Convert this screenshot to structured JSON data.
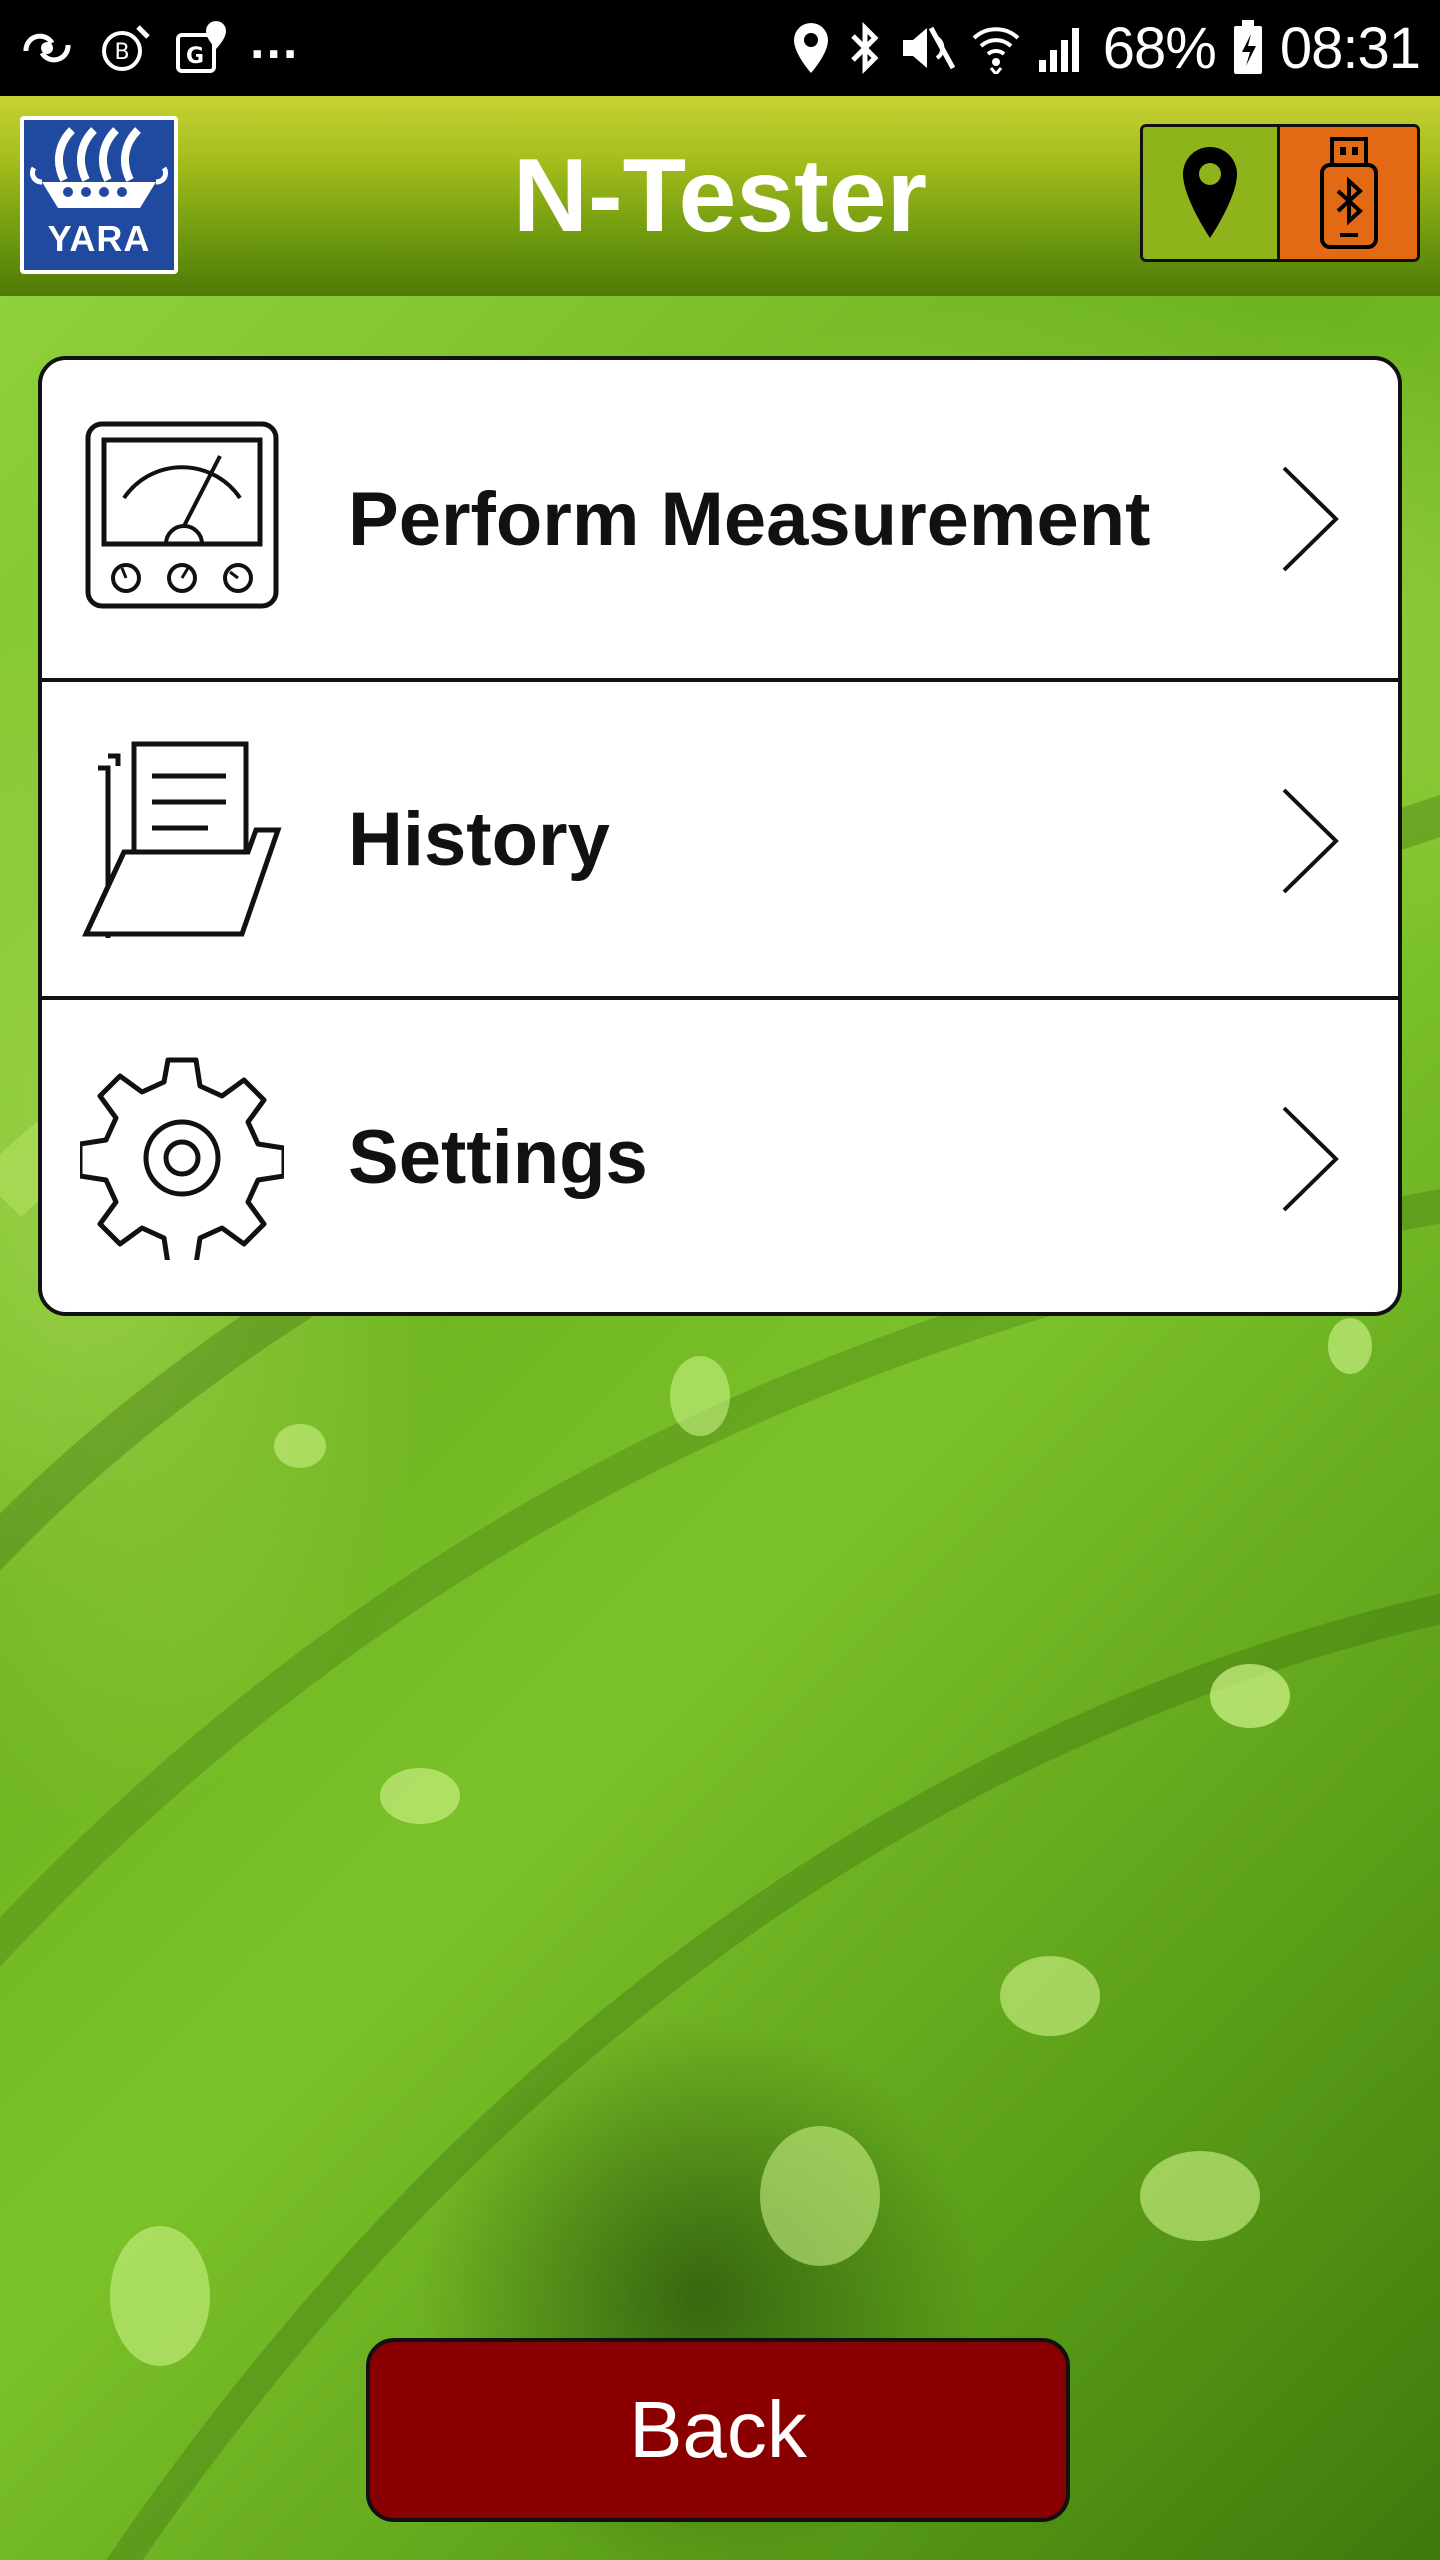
{
  "status_bar": {
    "battery_percent": "68%",
    "time": "08:31",
    "overflow": "...",
    "left_icons": [
      "sync-icon",
      "bitcoin-icon",
      "gps-map-icon"
    ],
    "right_icons": [
      "location-pin-icon",
      "bluetooth-icon",
      "mute-icon",
      "wifi-icon",
      "signal-icon",
      "battery-charging-icon"
    ]
  },
  "header": {
    "logo_text": "YARA",
    "title": "N-Tester",
    "buttons": [
      {
        "icon": "location-pin-icon",
        "color": "#8fb41b"
      },
      {
        "icon": "bluetooth-usb-icon",
        "color": "#e26a14"
      }
    ]
  },
  "menu": {
    "items": [
      {
        "label": "Perform Measurement",
        "icon": "gauge-meter-icon"
      },
      {
        "label": "History",
        "icon": "folder-documents-icon"
      },
      {
        "label": "Settings",
        "icon": "gear-icon"
      }
    ]
  },
  "back_button": {
    "label": "Back",
    "color": "#8a0000"
  }
}
